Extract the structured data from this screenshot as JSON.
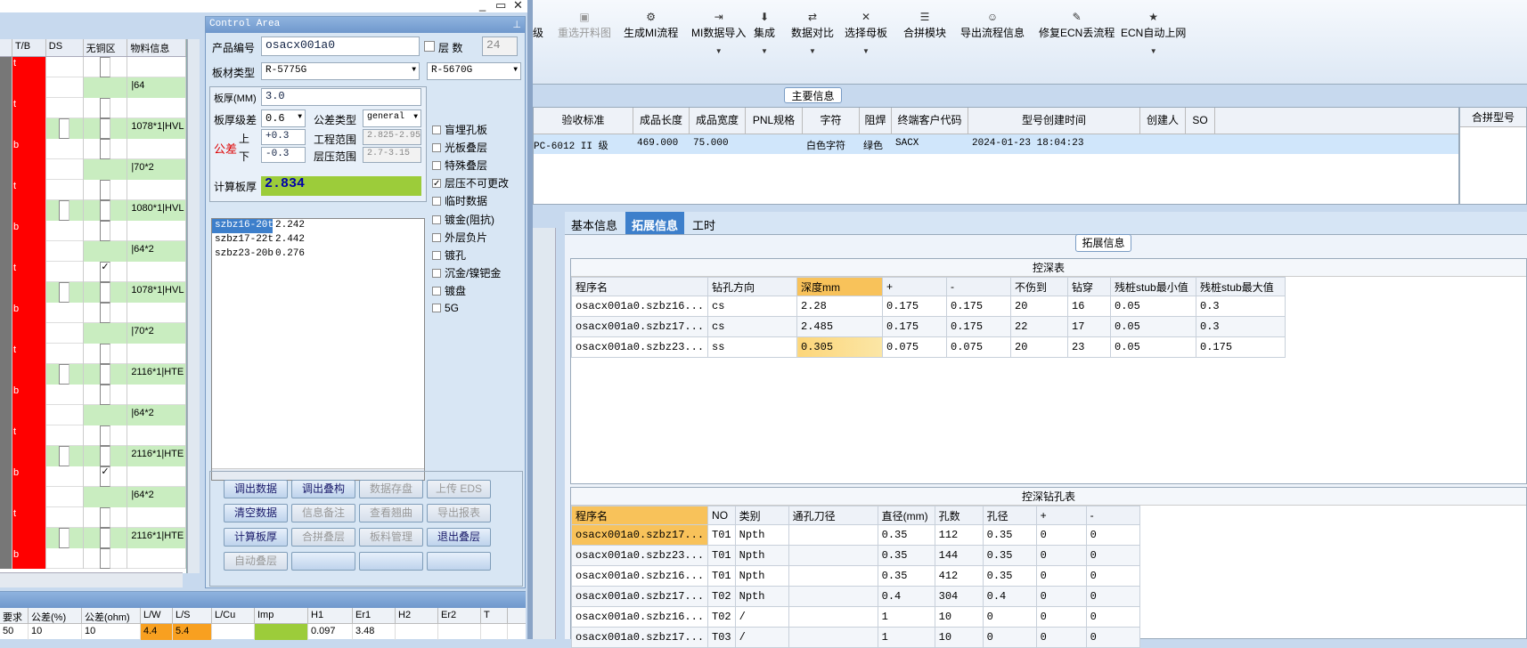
{
  "window_controls": [
    "_",
    "▭",
    "✕"
  ],
  "left_grid": {
    "headers": [
      "T/B",
      "DS",
      "无铜区",
      "物料信息"
    ],
    "rows": [
      {
        "tb": "t",
        "ds": false,
        "nocopper": true,
        "noc_checked": false,
        "material": ""
      },
      {
        "tb": "",
        "ds": false,
        "nocopper": false,
        "noc_checked": false,
        "material": "|64"
      },
      {
        "tb": "t",
        "ds": false,
        "nocopper": true,
        "noc_checked": false,
        "material": ""
      },
      {
        "tb": "",
        "ds": true,
        "nocopper": true,
        "noc_checked": false,
        "material": "1078*1|HVL"
      },
      {
        "tb": "b",
        "ds": false,
        "nocopper": true,
        "noc_checked": false,
        "material": ""
      },
      {
        "tb": "",
        "ds": false,
        "nocopper": false,
        "noc_checked": false,
        "material": "|70*2"
      },
      {
        "tb": "t",
        "ds": false,
        "nocopper": true,
        "noc_checked": false,
        "material": ""
      },
      {
        "tb": "",
        "ds": true,
        "nocopper": true,
        "noc_checked": false,
        "material": "1080*1|HVL"
      },
      {
        "tb": "b",
        "ds": false,
        "nocopper": true,
        "noc_checked": false,
        "material": ""
      },
      {
        "tb": "",
        "ds": false,
        "nocopper": false,
        "noc_checked": false,
        "material": "|64*2"
      },
      {
        "tb": "t",
        "ds": false,
        "nocopper": true,
        "noc_checked": true,
        "material": ""
      },
      {
        "tb": "",
        "ds": true,
        "nocopper": true,
        "noc_checked": false,
        "material": "1078*1|HVL"
      },
      {
        "tb": "b",
        "ds": false,
        "nocopper": true,
        "noc_checked": false,
        "material": ""
      },
      {
        "tb": "",
        "ds": false,
        "nocopper": false,
        "noc_checked": false,
        "material": "|70*2"
      },
      {
        "tb": "t",
        "ds": false,
        "nocopper": true,
        "noc_checked": false,
        "material": ""
      },
      {
        "tb": "",
        "ds": true,
        "nocopper": true,
        "noc_checked": false,
        "material": "2116*1|HTE"
      },
      {
        "tb": "b",
        "ds": false,
        "nocopper": true,
        "noc_checked": false,
        "material": ""
      },
      {
        "tb": "",
        "ds": false,
        "nocopper": false,
        "noc_checked": false,
        "material": "|64*2"
      },
      {
        "tb": "t",
        "ds": false,
        "nocopper": true,
        "noc_checked": false,
        "material": ""
      },
      {
        "tb": "",
        "ds": true,
        "nocopper": true,
        "noc_checked": false,
        "material": "2116*1|HTE"
      },
      {
        "tb": "b",
        "ds": false,
        "nocopper": true,
        "noc_checked": true,
        "material": ""
      },
      {
        "tb": "",
        "ds": false,
        "nocopper": false,
        "noc_checked": false,
        "material": "|64*2"
      },
      {
        "tb": "t",
        "ds": false,
        "nocopper": true,
        "noc_checked": false,
        "material": ""
      },
      {
        "tb": "",
        "ds": true,
        "nocopper": true,
        "noc_checked": false,
        "material": "2116*1|HTE"
      },
      {
        "tb": "b",
        "ds": false,
        "nocopper": true,
        "noc_checked": false,
        "material": ""
      }
    ]
  },
  "control": {
    "title": "Control Area",
    "pin": "⊥",
    "product_no_label": "产品编号",
    "product_no": "osacx001a0",
    "layers_label": "层 数",
    "layers": "24",
    "board_type_label": "板材类型",
    "board_type": "R-5775G",
    "board_type2": "R-5670G",
    "thickness_label": "板厚(MM)",
    "thickness": "3.0",
    "tol_grade_label": "板厚级差",
    "tol_grade": "0.6",
    "tol_type_label": "公差类型",
    "tol_type": "general",
    "tol_label": "公差",
    "upper_label": "上",
    "lower_label": "下",
    "upper": "+0.3",
    "lower": "-0.3",
    "eng_range_label": "工程范围",
    "eng_range": "2.825-2.95",
    "press_range_label": "层压范围",
    "press_range": "2.7-3.15",
    "calc_label": "计算板厚",
    "calc_value": "2.834",
    "checkboxes": [
      {
        "label": "盲埋孔板",
        "checked": false
      },
      {
        "label": "光板叠层",
        "checked": false
      },
      {
        "label": "特殊叠层",
        "checked": false
      },
      {
        "label": "层压不可更改",
        "checked": true
      },
      {
        "label": "临时数据",
        "checked": false
      },
      {
        "label": "镀金(阻抗)",
        "checked": false
      },
      {
        "label": "外层负片",
        "checked": false
      },
      {
        "label": "镀孔",
        "checked": false
      },
      {
        "label": "沉金/镍钯金",
        "checked": false
      },
      {
        "label": "镀盘",
        "checked": false
      },
      {
        "label": "5G",
        "checked": false
      }
    ],
    "sub_rows": [
      {
        "name": "szbz16-20t",
        "val": "2.242"
      },
      {
        "name": "szbz17-22t",
        "val": "2.442"
      },
      {
        "name": "szbz23-20b",
        "val": "0.276"
      }
    ],
    "buttons": [
      [
        "调出数据",
        "调出叠构",
        "数据存盘",
        "上传 EDS"
      ],
      [
        "清空数据",
        "信息备注",
        "查看翘曲",
        "导出报表"
      ],
      [
        "计算板厚",
        "合拼叠层",
        "板料管理",
        "退出叠层"
      ],
      [
        "自动叠层",
        "",
        "",
        ""
      ]
    ]
  },
  "bottom_grid": {
    "headers": [
      "要求",
      "公差(%)",
      "公差(ohm)",
      "L/W",
      "L/S",
      "L/Cu",
      "Imp",
      "H1",
      "Er1",
      "H2",
      "Er2",
      "T"
    ],
    "row": [
      "50",
      "10",
      "10",
      "4.4",
      "5.4",
      "",
      "",
      "0.097",
      "3.48",
      "",
      "",
      ""
    ]
  },
  "toolbar": [
    {
      "icon": "",
      "label": "级"
    },
    {
      "icon": "▣",
      "label": "重选开料图",
      "disabled": true
    },
    {
      "icon": "⚙",
      "label": "生成MI流程"
    },
    {
      "icon": "⇥",
      "label": "MI数据导入",
      "dd": true
    },
    {
      "icon": "⬇",
      "label": "集成",
      "dd": true
    },
    {
      "icon": "⇄",
      "label": "数据对比",
      "dd": true
    },
    {
      "icon": "✕",
      "label": "选择母板",
      "dd": true
    },
    {
      "icon": "☰",
      "label": "合拼模块"
    },
    {
      "icon": "☺",
      "label": "导出流程信息"
    },
    {
      "icon": "✎",
      "label": "修复ECN丢流程"
    },
    {
      "icon": "★",
      "label": "ECN自动上网",
      "dd": true
    }
  ],
  "main_info": {
    "title": "主要信息",
    "headers": [
      "验收标准",
      "成品长度",
      "成品宽度",
      "PNL规格",
      "字符",
      "阻焊",
      "终端客户代码",
      "型号创建时间",
      "创建人",
      "SO"
    ],
    "row": [
      "PC-6012 II 级",
      "469.000",
      "75.000",
      "",
      "白色字符",
      "绿色",
      "SACX",
      "2024-01-23 18:04:23",
      "",
      ""
    ],
    "right_header": "合拼型号"
  },
  "tabs": [
    "基本信息",
    "拓展信息",
    "工时"
  ],
  "ext_title": "拓展信息",
  "depth_table": {
    "title": "控深表",
    "headers": [
      "程序名",
      "钻孔方向",
      "深度mm",
      "+",
      "-",
      "不伤到",
      "钻穿",
      "残桩stub最小值",
      "残桩stub最大值"
    ],
    "rows": [
      [
        "osacx001a0.szbz16...",
        "cs",
        "2.28",
        "0.175",
        "0.175",
        "20",
        "16",
        "0.05",
        "0.3"
      ],
      [
        "osacx001a0.szbz17...",
        "cs",
        "2.485",
        "0.175",
        "0.175",
        "22",
        "17",
        "0.05",
        "0.3"
      ],
      [
        "osacx001a0.szbz23...",
        "ss",
        "0.305",
        "0.075",
        "0.075",
        "20",
        "23",
        "0.05",
        "0.175"
      ]
    ]
  },
  "drill_table": {
    "title": "控深钻孔表",
    "headers": [
      "程序名",
      "NO",
      "类别",
      "通孔刀径",
      "直径(mm)",
      "孔数",
      "孔径",
      "+",
      "-"
    ],
    "rows": [
      [
        "osacx001a0.szbz17...",
        "T01",
        "Npth",
        "",
        "0.35",
        "112",
        "0.35",
        "0",
        "0"
      ],
      [
        "osacx001a0.szbz23...",
        "T01",
        "Npth",
        "",
        "0.35",
        "144",
        "0.35",
        "0",
        "0"
      ],
      [
        "osacx001a0.szbz16...",
        "T01",
        "Npth",
        "",
        "0.35",
        "412",
        "0.35",
        "0",
        "0"
      ],
      [
        "osacx001a0.szbz17...",
        "T02",
        "Npth",
        "",
        "0.4",
        "304",
        "0.4",
        "0",
        "0"
      ],
      [
        "osacx001a0.szbz16...",
        "T02",
        "/",
        "",
        "1",
        "10",
        "0",
        "0",
        "0"
      ],
      [
        "osacx001a0.szbz17...",
        "T03",
        "/",
        "",
        "1",
        "10",
        "0",
        "0",
        "0"
      ]
    ]
  }
}
